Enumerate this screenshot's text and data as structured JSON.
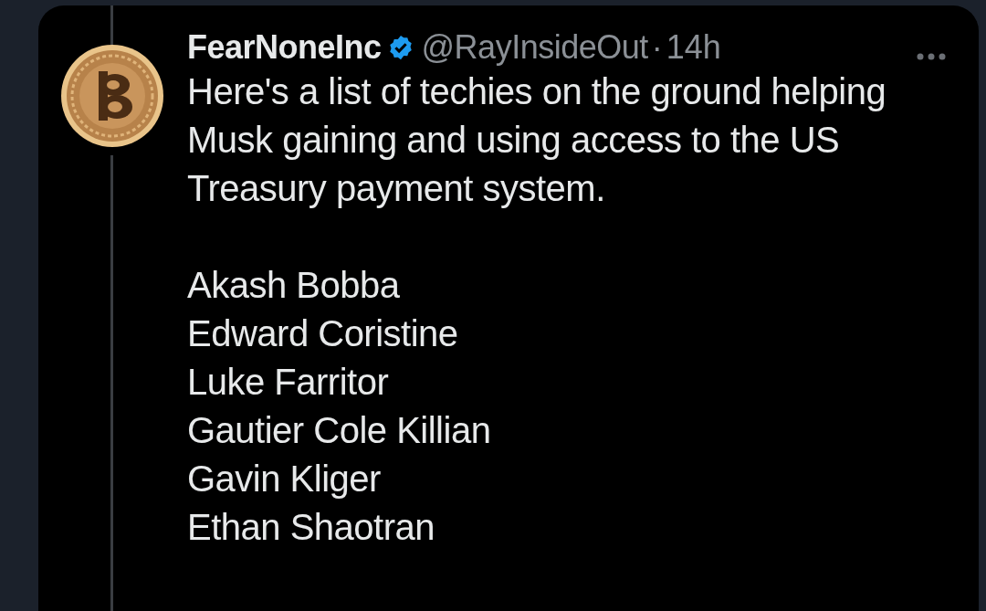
{
  "tweet": {
    "author_name": "FearNoneInc",
    "verified": true,
    "handle": "@RayInsideOut",
    "separator": "·",
    "time": "14h",
    "text": "Here's a list of techies on the ground helping Musk gaining and using access to the US Treasury payment system.",
    "names": [
      "Akash Bobba",
      "Edward Coristine",
      "Luke Farritor",
      "Gautier Cole Killian",
      "Gavin Kliger",
      "Ethan Shaotran"
    ]
  }
}
